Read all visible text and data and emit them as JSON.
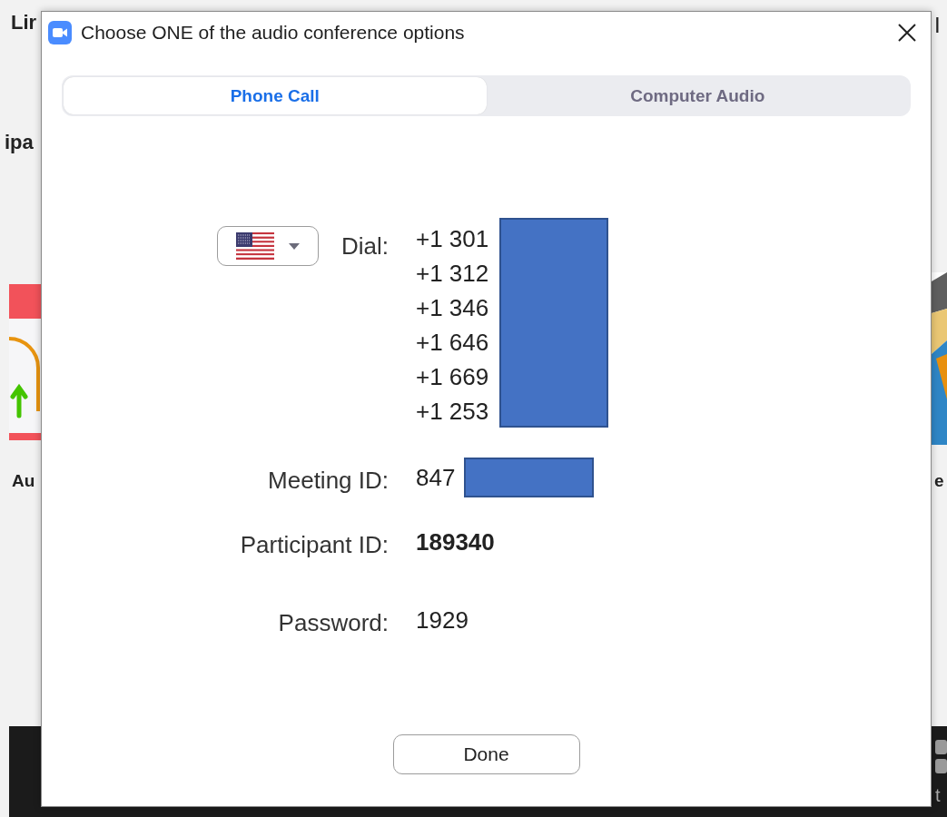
{
  "background": {
    "texts": [
      {
        "text": "Lir"
      },
      {
        "text": "ipa"
      },
      {
        "text": "Au"
      },
      {
        "text": "I"
      },
      {
        "text": "e"
      },
      {
        "text": "t"
      }
    ]
  },
  "window": {
    "title": "Choose ONE of the audio conference options"
  },
  "tabs": [
    {
      "label": "Phone Call",
      "selected": true
    },
    {
      "label": "Computer Audio",
      "selected": false
    }
  ],
  "dial": {
    "label": "Dial:",
    "redacted": true,
    "numbers": [
      "+1 301",
      "+1 312",
      "+1 346",
      "+1 646",
      "+1 669",
      "+1 253"
    ]
  },
  "fields": [
    {
      "label": "Meeting ID:",
      "value": "847",
      "redacted": true,
      "bold": false
    },
    {
      "label": "Participant ID:",
      "value": "189340",
      "redacted": false,
      "bold": true
    },
    {
      "label": "Password:",
      "value": "1929",
      "redacted": false,
      "bold": false
    }
  ],
  "buttons": [
    "Done"
  ]
}
